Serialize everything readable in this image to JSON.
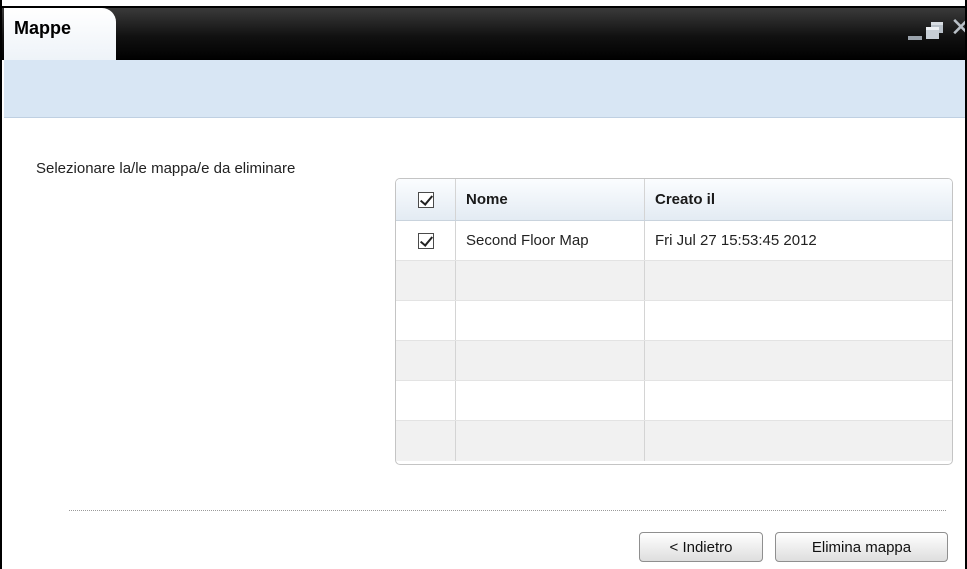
{
  "window": {
    "title": "Mappe",
    "controls": {
      "minimize_icon": "minimize-icon",
      "maximize_icon": "maximize-icon",
      "close_icon": "close-icon"
    }
  },
  "main": {
    "prompt": "Selezionare la/le mappa/e da eliminare",
    "table": {
      "columns": [
        "Nome",
        "Creato il"
      ],
      "header_checked": true,
      "rows": [
        {
          "checked": true,
          "name": "Second Floor Map",
          "created": "Fri Jul 27 15:53:45 2012"
        }
      ]
    }
  },
  "footer": {
    "back_label": "< Indietro",
    "delete_label": "Elimina mappa"
  },
  "colors": {
    "header_band": "#d8e6f4",
    "titlebar": "#000000"
  }
}
